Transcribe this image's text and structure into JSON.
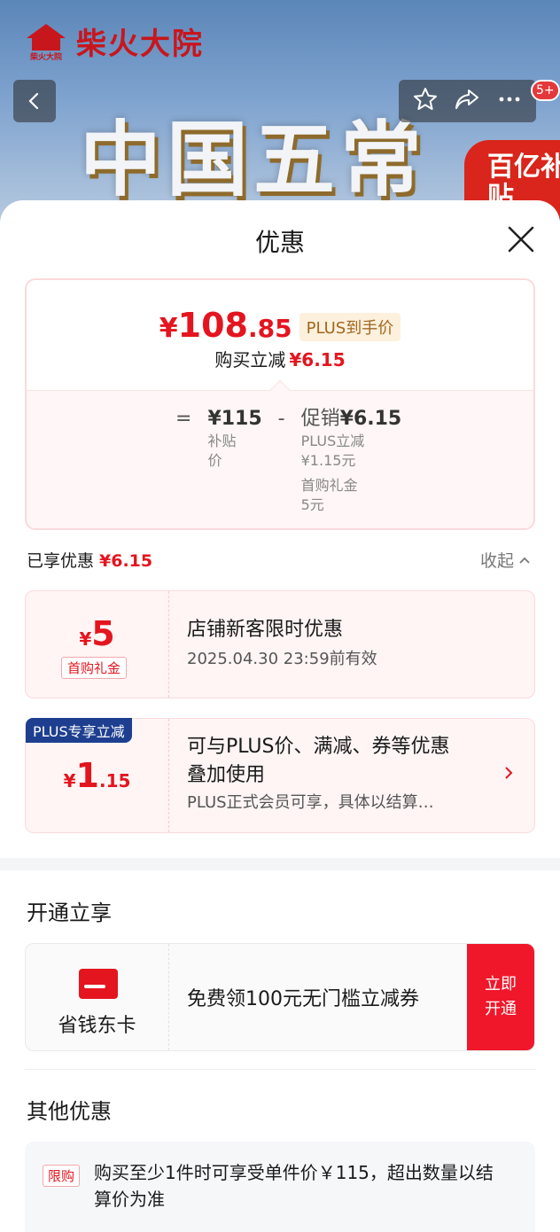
{
  "banner": {
    "brand_name": "柴火大院",
    "brand_logo_text": "柴火大院",
    "headline": "中国五常",
    "subsidy_badge": "百亿补贴",
    "cart_badge_count": "5+"
  },
  "sheet": {
    "title": "优惠",
    "price": {
      "yen": "¥",
      "integer": "108",
      "decimal": ".85",
      "plus_tag": "PLUS到手价",
      "instant_label": "购买立减",
      "instant_amount": "¥6.15"
    },
    "calc": {
      "equals": "=",
      "minus": "-",
      "base_value": "¥115",
      "base_label": "补贴价",
      "promo_label": "促销",
      "promo_value": "¥6.15",
      "detail_1_label": "PLUS立减",
      "detail_1_value": "¥1.15元",
      "detail_2_label": "首购礼金",
      "detail_2_value": "5元"
    },
    "enjoyed": {
      "label": "已享优惠",
      "amount": "¥6.15",
      "collapse": "收起"
    },
    "coupons": [
      {
        "yen": "¥",
        "amount": "5",
        "tag": "首购礼金",
        "title": "店铺新客限时优惠",
        "subtitle": "2025.04.30 23:59前有效"
      },
      {
        "corner": "PLUS专享立减",
        "yen": "¥",
        "amount": "1",
        "decimal": ".15",
        "title_line1": "可与PLUS价、满减、券等优惠",
        "title_line2": "叠加使用",
        "subtitle": "PLUS正式会员可享，具体以结算…"
      }
    ],
    "open_section": {
      "title": "开通立享",
      "card_name": "省钱东卡",
      "offer": "免费领100元无门槛立减券",
      "button_line1": "立即",
      "button_line2": "开通"
    },
    "other_section": {
      "title": "其他优惠",
      "tag": "限购",
      "text": "购买至少1件时可享受单件价￥115，超出数量以结算价为准"
    }
  },
  "colors": {
    "accent_red": "#e4151f",
    "plus_blue": "#1e3f8f",
    "open_button": "#f0172b"
  }
}
